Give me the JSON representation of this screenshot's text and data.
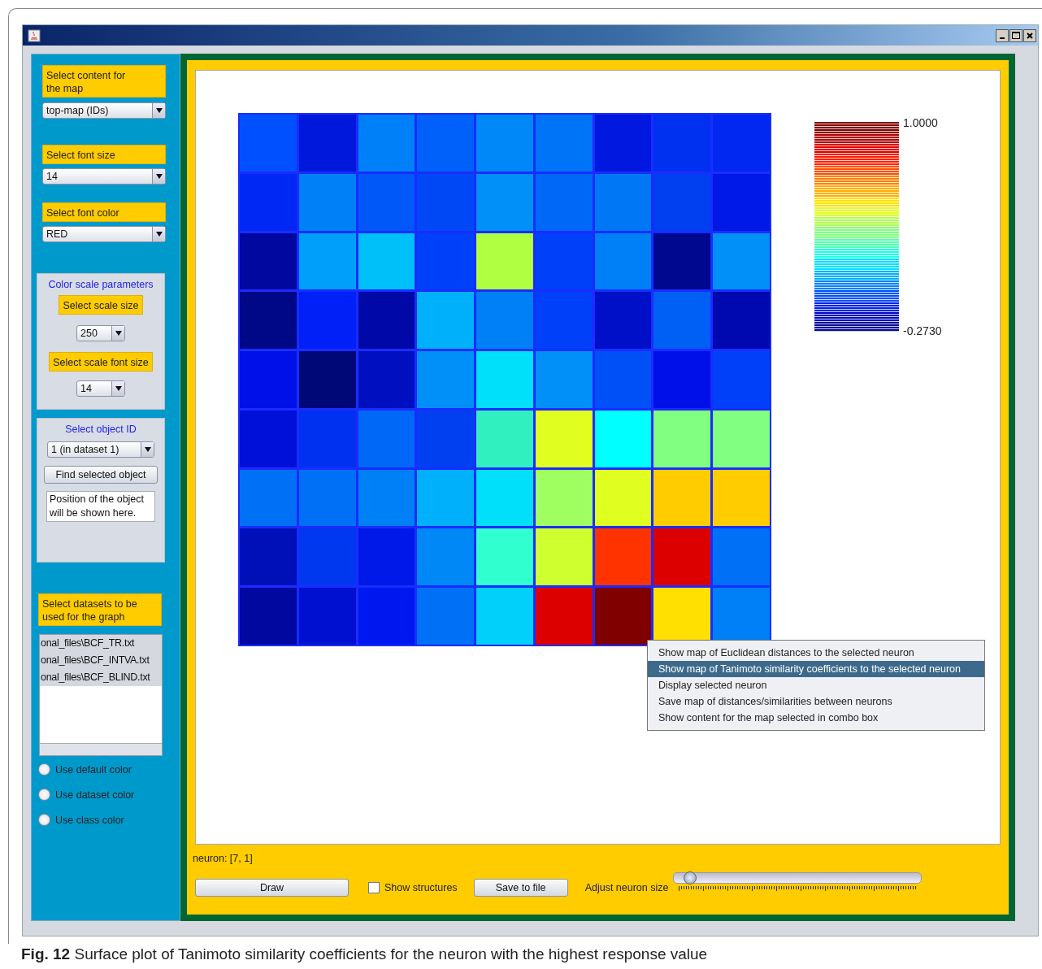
{
  "sidebar": {
    "map_content": {
      "label": "Select content for the map",
      "value": "top-map (IDs)"
    },
    "font_size": {
      "label": "Select font size",
      "value": "14"
    },
    "font_color": {
      "label": "Select font color",
      "value": "RED"
    },
    "color_scale": {
      "title": "Color scale parameters",
      "size_label": "Select scale size",
      "size_value": "250",
      "font_label": "Select scale font size",
      "font_value": "14"
    },
    "object": {
      "title": "Select object ID",
      "value": "1 (in dataset 1)",
      "button": "Find selected object",
      "output": "Position of the object will be shown here."
    },
    "datasets": {
      "label": "Select datasets to be used for the graph",
      "files": [
        {
          "name": "onal_files\\BCF_TR.txt",
          "selected": true
        },
        {
          "name": "onal_files\\BCF_INTVA.txt",
          "selected": true
        },
        {
          "name": "onal_files\\BCF_BLIND.txt",
          "selected": true
        }
      ]
    },
    "color_modes": [
      {
        "label": "Use default color",
        "selected": false
      },
      {
        "label": "Use dataset color",
        "selected": false
      },
      {
        "label": "Use class color",
        "selected": false
      }
    ]
  },
  "map": {
    "rows": [
      {
        "cells": [
          {
            "color": "#0050ff"
          },
          {
            "color": "#0018dc"
          },
          {
            "color": "#0080f8"
          },
          {
            "color": "#0060fa"
          },
          {
            "color": "#0088f8"
          },
          {
            "color": "#0074f6"
          },
          {
            "color": "#0018e0"
          },
          {
            "color": "#0030f0"
          },
          {
            "color": "#0028f0"
          }
        ]
      },
      {
        "cells": [
          {
            "color": "#0028f4"
          },
          {
            "color": "#0080f6"
          },
          {
            "color": "#0058f8"
          },
          {
            "color": "#0048f6"
          },
          {
            "color": "#0090f8"
          },
          {
            "color": "#0068f6"
          },
          {
            "color": "#0078f6"
          },
          {
            "color": "#0040f0"
          },
          {
            "color": "#0018e8"
          }
        ]
      },
      {
        "cells": [
          {
            "color": "#0008a0"
          },
          {
            "color": "#00a0fa"
          },
          {
            "color": "#00c0fa"
          },
          {
            "color": "#0040f8"
          },
          {
            "color": "#b0ff40"
          },
          {
            "color": "#0040f8"
          },
          {
            "color": "#0080f6"
          },
          {
            "color": "#000890"
          },
          {
            "color": "#0090f8"
          }
        ]
      },
      {
        "cells": [
          {
            "color": "#000888"
          },
          {
            "color": "#0020f8"
          },
          {
            "color": "#0008a8"
          },
          {
            "color": "#00b0fa"
          },
          {
            "color": "#0080f6"
          },
          {
            "color": "#0040f8"
          },
          {
            "color": "#0010c8"
          },
          {
            "color": "#0060f6"
          },
          {
            "color": "#0008b0"
          }
        ]
      },
      {
        "cells": [
          {
            "color": "#0010e8"
          },
          {
            "color": "#000878"
          },
          {
            "color": "#0010c0"
          },
          {
            "color": "#0090f8"
          },
          {
            "color": "#00e0fa"
          },
          {
            "color": "#0090f8"
          },
          {
            "color": "#0050f8"
          },
          {
            "color": "#0010e8"
          },
          {
            "color": "#0040f8"
          }
        ]
      },
      {
        "cells": [
          {
            "color": "#0010d8"
          },
          {
            "color": "#0030f0"
          },
          {
            "color": "#0068f6"
          },
          {
            "color": "#0040f0"
          },
          {
            "color": "#30f0c0"
          },
          {
            "color": "#e0ff20"
          },
          {
            "color": "#00ffff"
          },
          {
            "color": "#80ff80"
          },
          {
            "color": "#80ff80"
          }
        ]
      },
      {
        "cells": [
          {
            "color": "#0070f6"
          },
          {
            "color": "#0070f6"
          },
          {
            "color": "#0080f6"
          },
          {
            "color": "#00b0fa"
          },
          {
            "color": "#00e0fa"
          },
          {
            "color": "#a0ff60"
          },
          {
            "color": "#e0ff20"
          },
          {
            "color": "#ffcc00"
          },
          {
            "color": "#ffcc00"
          }
        ]
      },
      {
        "cells": [
          {
            "color": "#0010b8"
          },
          {
            "color": "#0038f0"
          },
          {
            "color": "#0018e8"
          },
          {
            "color": "#0088f6"
          },
          {
            "color": "#30ffd0"
          },
          {
            "color": "#d0ff30"
          },
          {
            "color": "#ff3300"
          },
          {
            "color": "#dd0000"
          },
          {
            "color": "#0070f6"
          }
        ]
      },
      {
        "cells": [
          {
            "color": "#0008a0"
          },
          {
            "color": "#0010d0"
          },
          {
            "color": "#0018f0"
          },
          {
            "color": "#0070f6"
          },
          {
            "color": "#00d0fa"
          },
          {
            "color": "#dd0000"
          },
          {
            "color": "#800000"
          },
          {
            "color": "#ffe000"
          },
          {
            "color": "#0080f6"
          }
        ]
      }
    ]
  },
  "legend": {
    "max": "1.0000",
    "min": "-0.2730"
  },
  "context_menu": [
    {
      "label": "Show map of Euclidean distances to the selected neuron",
      "selected": false
    },
    {
      "label": "Show map of Tanimoto similarity coefficients to the selected neuron",
      "selected": true
    },
    {
      "label": "Display selected neuron",
      "selected": false
    },
    {
      "label": "Save map of distances/similarities between neurons",
      "selected": false
    },
    {
      "label": "Show content for the map selected in combo box",
      "selected": false
    }
  ],
  "status": "neuron: [7, 1]",
  "toolbar": {
    "draw": "Draw",
    "show_structures": {
      "label": "Show structures",
      "checked": false
    },
    "save": "Save to file",
    "slider": {
      "label": "Adjust neuron size",
      "level": 0.06
    }
  },
  "caption": "**Fig. 12**  Surface plot of Tanimoto similarity coefficients for the neuron with the highest response value"
}
